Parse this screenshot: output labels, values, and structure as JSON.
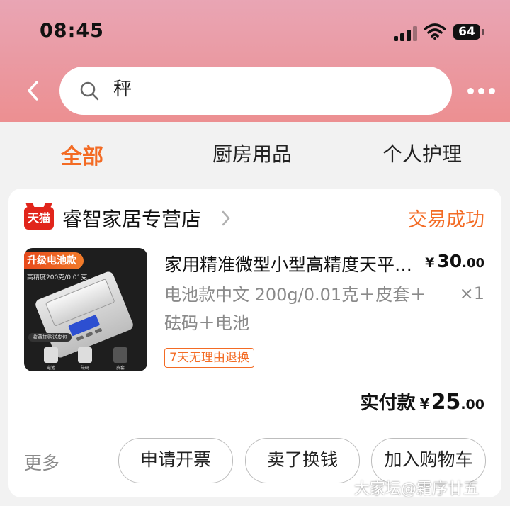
{
  "status_bar": {
    "time": "08:45",
    "battery": "64"
  },
  "search": {
    "query": "秤"
  },
  "tabs": [
    {
      "label": "全部",
      "active": true
    },
    {
      "label": "厨房用品",
      "active": false
    },
    {
      "label": "个人护理",
      "active": false
    }
  ],
  "order": {
    "shop_badge": "天猫",
    "shop_name": "睿智家居专营店",
    "status": "交易成功",
    "product": {
      "image_banner": "升级电池款",
      "image_subtitle": "高精度200克/0.01克",
      "image_strip": "收藏加购送皮包",
      "image_icon_labels": [
        "电池",
        "砝码",
        "皮套"
      ],
      "title": "家用精准微型小型高精度天平电子秤",
      "price_symbol": "¥",
      "price_int": "30",
      "price_dec": ".00",
      "spec": "电池款中文 200g/0.01克＋皮套＋砝码＋电池",
      "quantity": "×1",
      "tag": "7天无理由退换"
    },
    "paid_label": "实付款",
    "paid_symbol": "¥",
    "paid_int": "25",
    "paid_dec": ".00",
    "more_label": "更多",
    "buttons": {
      "invoice": "申请开票",
      "resell": "卖了换钱",
      "add_cart": "加入购物车"
    }
  },
  "watermark": "大家坛@霜序廿五",
  "colors": {
    "accent": "#f36b24",
    "tmall_red": "#e1251b",
    "header_top": "#e9a5b4",
    "header_bottom": "#ec8f91"
  }
}
